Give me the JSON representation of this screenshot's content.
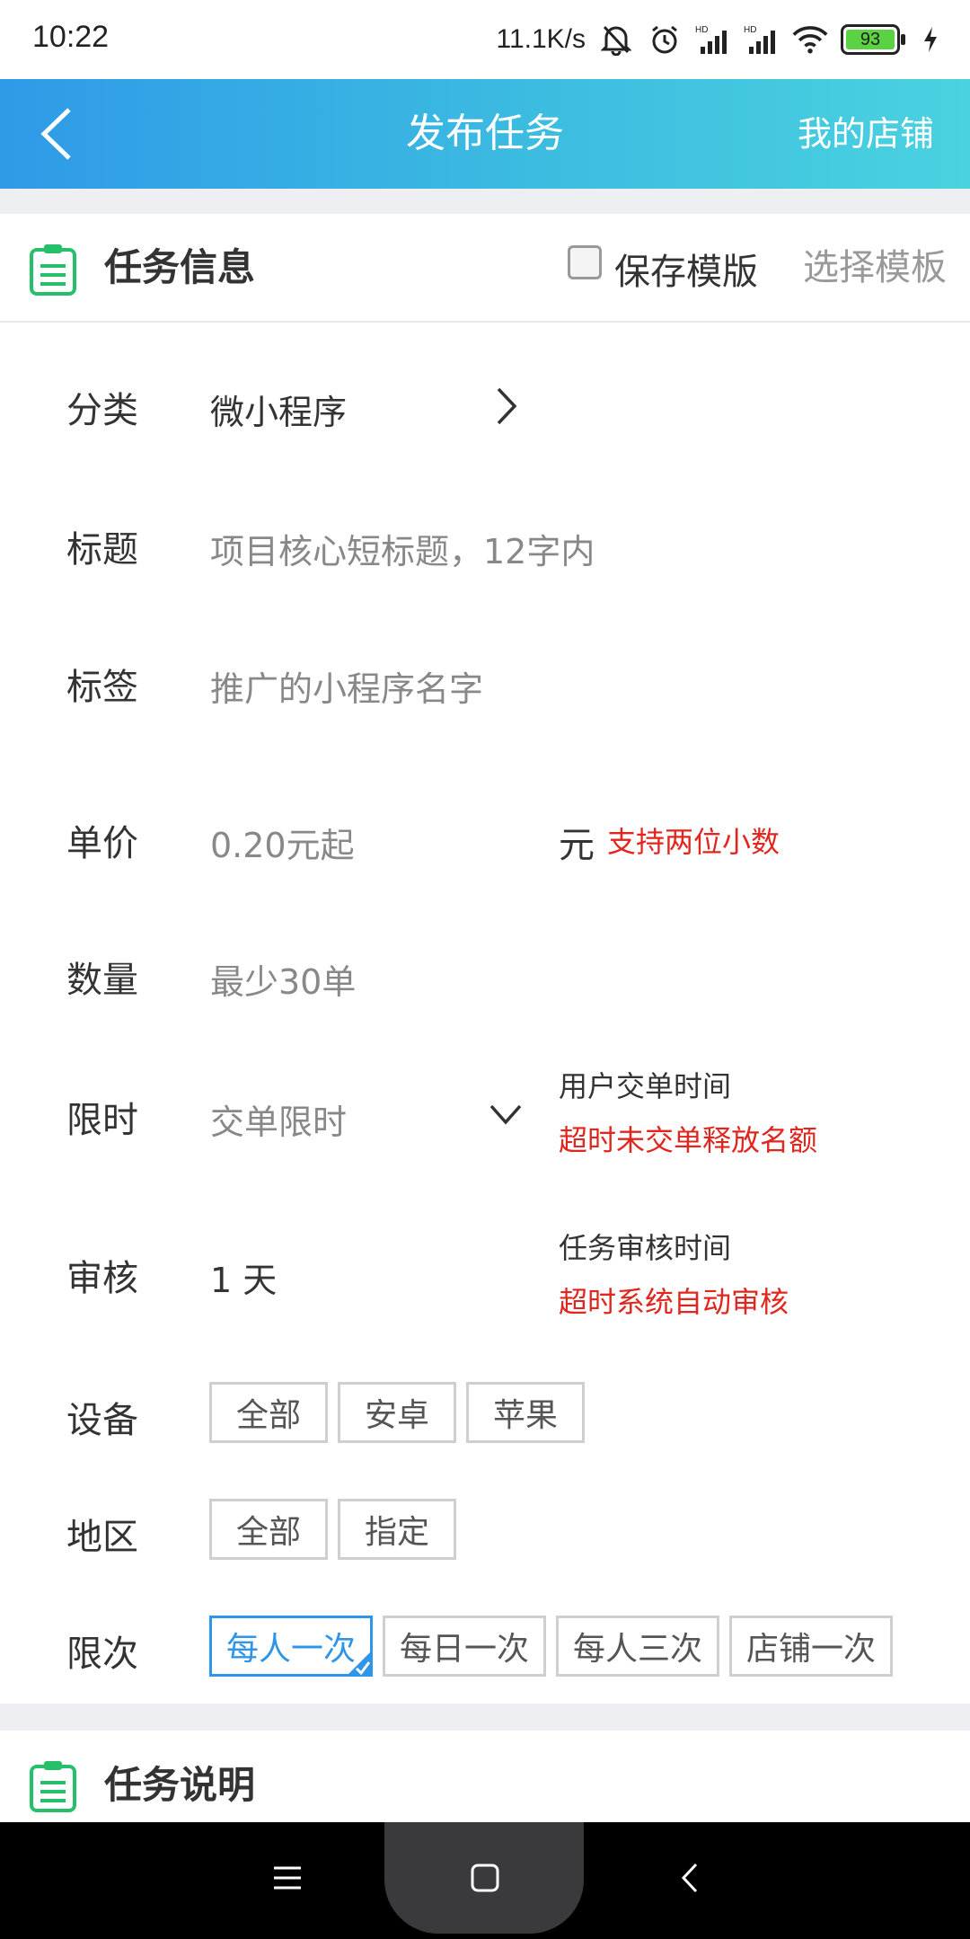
{
  "status": {
    "time": "10:22",
    "speed": "11.1K/s",
    "battery": "93"
  },
  "header": {
    "title": "发布任务",
    "right_link": "我的店铺"
  },
  "task_info": {
    "title": "任务信息",
    "save_template": "保存模版",
    "choose_template": "选择模板"
  },
  "form": {
    "category": {
      "label": "分类",
      "value": "微小程序"
    },
    "title": {
      "label": "标题",
      "placeholder": "项目核心短标题，12字内"
    },
    "tag": {
      "label": "标签",
      "placeholder": "推广的小程序名字"
    },
    "price": {
      "label": "单价",
      "placeholder": "0.20元起",
      "unit": "元",
      "note": "支持两位小数"
    },
    "quantity": {
      "label": "数量",
      "placeholder": "最少30单"
    },
    "time_limit": {
      "label": "限时",
      "placeholder": "交单限时",
      "hint": "用户交单时间",
      "hint_red": "超时未交单释放名额"
    },
    "review": {
      "label": "审核",
      "value": "1 天",
      "hint": "任务审核时间",
      "hint_red": "超时系统自动审核"
    },
    "device": {
      "label": "设备",
      "options": [
        "全部",
        "安卓",
        "苹果"
      ]
    },
    "region": {
      "label": "地区",
      "options": [
        "全部",
        "指定"
      ]
    },
    "limit": {
      "label": "限次",
      "options": [
        "每人一次",
        "每日一次",
        "每人三次",
        "店铺一次"
      ],
      "selected": "每人一次"
    }
  },
  "task_desc": {
    "title": "任务说明"
  },
  "colors": {
    "header_gradient_start": "#2f9ae8",
    "header_gradient_end": "#4ad2e0",
    "accent_blue": "#2f95e8",
    "warning_red": "#e0261e",
    "icon_green": "#27c06a"
  }
}
